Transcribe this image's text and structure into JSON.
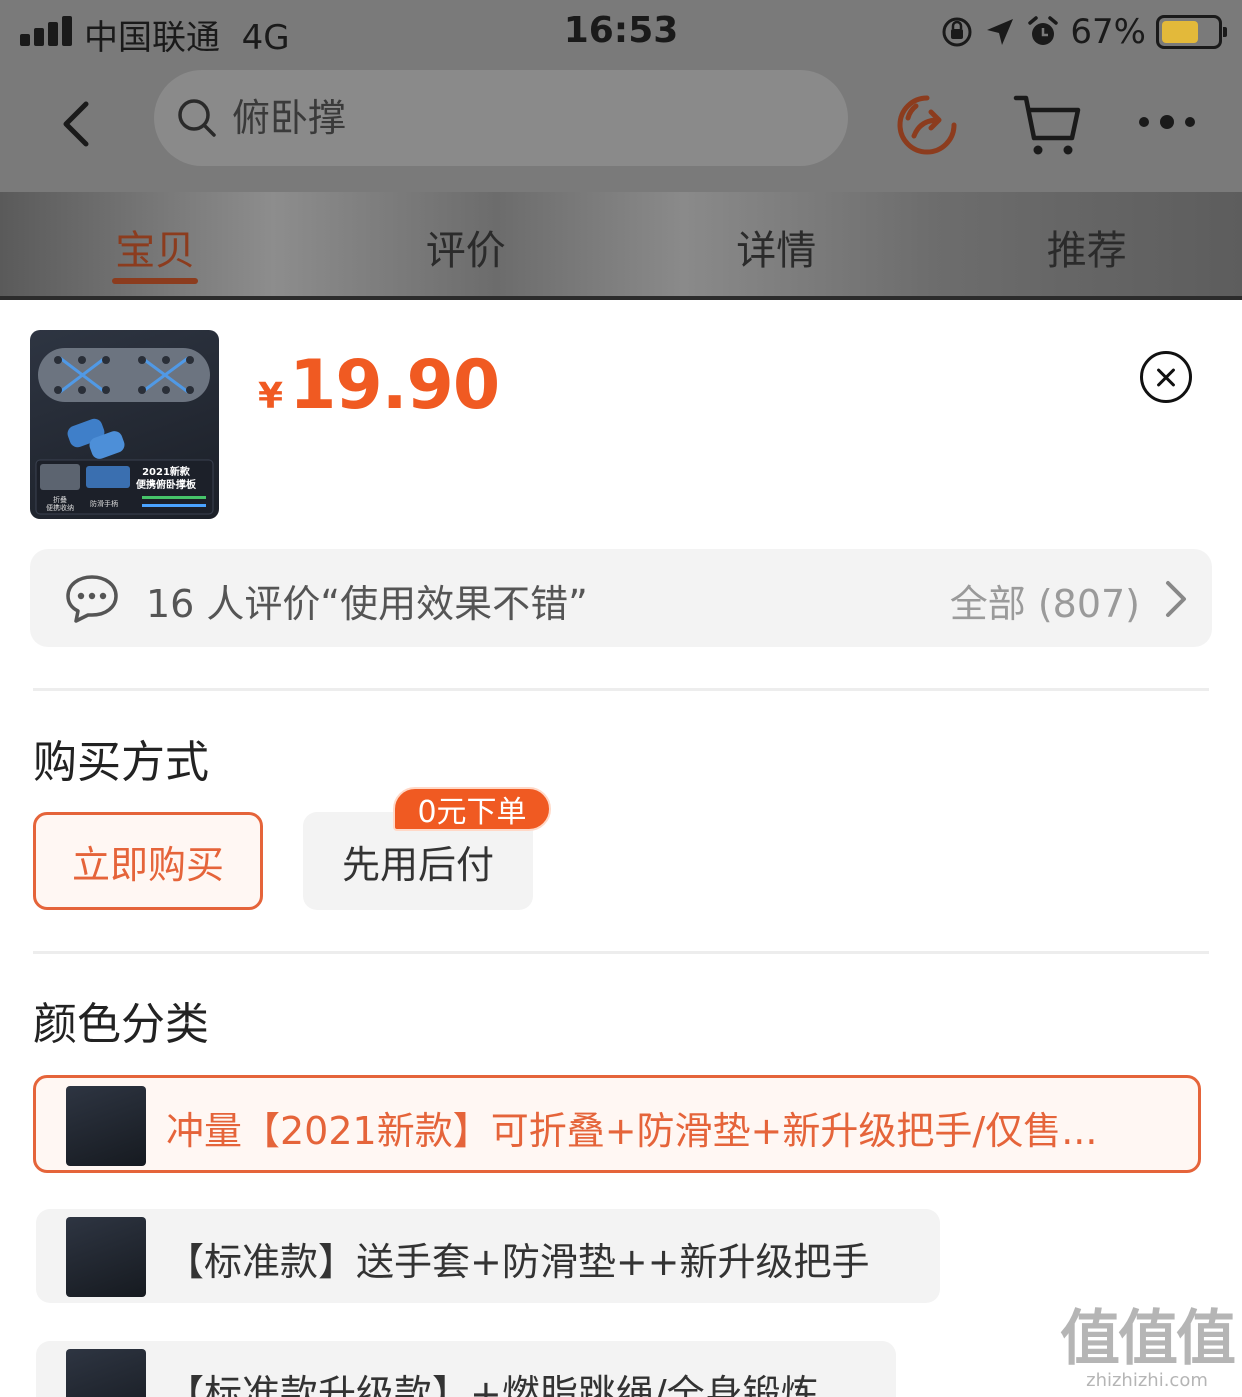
{
  "status_bar": {
    "carrier": "中国联通",
    "network": "4G",
    "time": "16:53",
    "battery_percent": "67%",
    "battery_level": 0.67,
    "battery_color": "#e3b93a",
    "icons": [
      "signal-icon",
      "orientation-lock-icon",
      "location-arrow-icon",
      "alarm-icon",
      "battery-icon"
    ]
  },
  "nav": {
    "search_placeholder": "俯卧撑",
    "icons": [
      "back-icon",
      "search-icon",
      "share-icon",
      "cart-icon",
      "more-icon"
    ]
  },
  "tabs": [
    {
      "label": "宝贝",
      "active": true
    },
    {
      "label": "评价",
      "active": false
    },
    {
      "label": "详情",
      "active": false
    },
    {
      "label": "推荐",
      "active": false
    }
  ],
  "product": {
    "currency": "¥",
    "price": "19.90",
    "thumb_caption": "2021新款\n便携俯卧撑板",
    "thumb_left_caption": "折叠\n便携收纳",
    "thumb_mid_caption": "防滑手柄"
  },
  "review": {
    "text": "16 人评价“使用效果不错”",
    "all": "全部 (807)"
  },
  "purchase": {
    "title": "购买方式",
    "options": [
      {
        "label": "立即购买",
        "selected": true
      },
      {
        "label": "先用后付",
        "selected": false
      }
    ],
    "badge": "0元下单"
  },
  "color": {
    "title": "颜色分类",
    "options": [
      {
        "label": "冲量【2021新款】可折叠+防滑垫+新升级把手/仅售...",
        "selected": true
      },
      {
        "label": "【标准款】送手套+防滑垫++新升级把手",
        "selected": false
      },
      {
        "label": "【标准款升级款】+燃脂跳绳/全身锻炼",
        "selected": false
      }
    ]
  },
  "watermark": {
    "big": "值值值",
    "small": "zhizhizhi.com"
  },
  "colors": {
    "accent": "#f05a22",
    "accent_border": "#e5643a",
    "tab_active": "#8c3c1e",
    "option_bg": "#f3f3f3"
  }
}
